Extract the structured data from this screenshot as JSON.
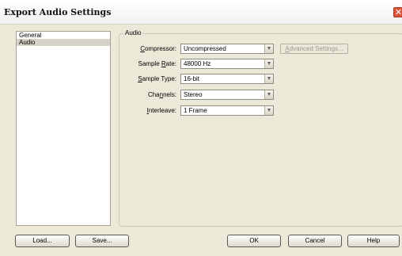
{
  "window": {
    "title": "Export Audio Settings",
    "close_glyph": "✕"
  },
  "nav": {
    "items": [
      {
        "label": "General",
        "selected": false
      },
      {
        "label": "Audio",
        "selected": true
      }
    ]
  },
  "audio": {
    "group_label": "Audio",
    "compressor": {
      "label_u": "C",
      "label_rest": "ompressor:",
      "value": "Uncompressed"
    },
    "sample_rate": {
      "label_pre": "Sample ",
      "label_u": "R",
      "label_post": "ate:",
      "value": "48000 Hz"
    },
    "sample_type": {
      "label_u": "S",
      "label_rest": "ample Type:",
      "value": "16-bit"
    },
    "channels": {
      "label_pre": "Cha",
      "label_u": "n",
      "label_post": "nels:",
      "value": "Stereo"
    },
    "interleave": {
      "label_u": "I",
      "label_rest": "nterleave:",
      "value": "1 Frame"
    },
    "advanced_button": {
      "label_u": "A",
      "label_rest": "dvanced Settings..."
    }
  },
  "dropdown_glyph": "▼",
  "buttons": {
    "load": "Load...",
    "save": "Save...",
    "ok": "OK",
    "cancel": "Cancel",
    "help": "Help"
  }
}
